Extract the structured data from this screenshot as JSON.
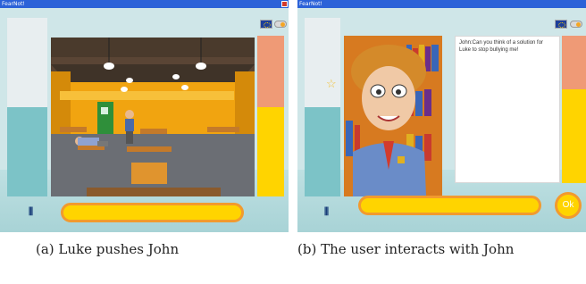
{
  "screens": [
    {
      "window_title": "FearNot!"
    },
    {
      "window_title": "FearNot!"
    }
  ],
  "dialogue": "John:Can you think of a solution for Luke to stop bullying me!",
  "ok_label": "Ok",
  "captions": {
    "a": "(a) Luke pushes John",
    "b": "(b) The user interacts with John"
  },
  "colors": {
    "accent": "#ffd400",
    "border_orange": "#f29a2e",
    "teal": "#7cc3c7",
    "salmon": "#ef9a76"
  }
}
